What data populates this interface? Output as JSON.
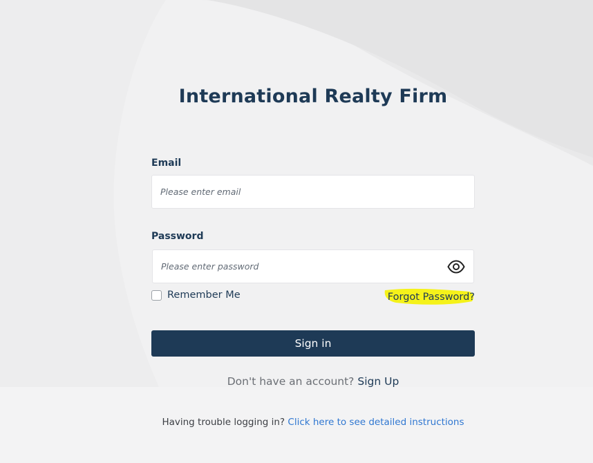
{
  "app": {
    "title": "International Realty Firm"
  },
  "form": {
    "email": {
      "label": "Email",
      "placeholder": "Please enter email",
      "value": ""
    },
    "password": {
      "label": "Password",
      "placeholder": "Please enter password",
      "value": "",
      "toggle_icon": "eye-icon"
    },
    "remember": {
      "label": "Remember Me",
      "checked": false
    },
    "forgot_label": "Forgot Password?",
    "signin_label": "Sign in"
  },
  "signup": {
    "prompt": "Don't have an account?",
    "link_label": "Sign Up"
  },
  "help": {
    "prompt": "Having trouble logging in?",
    "link_label": "Click here to see detailed instructions"
  },
  "colors": {
    "primary": "#1e3a56",
    "link": "#2f77d1",
    "highlight": "#f5f21a",
    "background": "#f1f1f2"
  }
}
